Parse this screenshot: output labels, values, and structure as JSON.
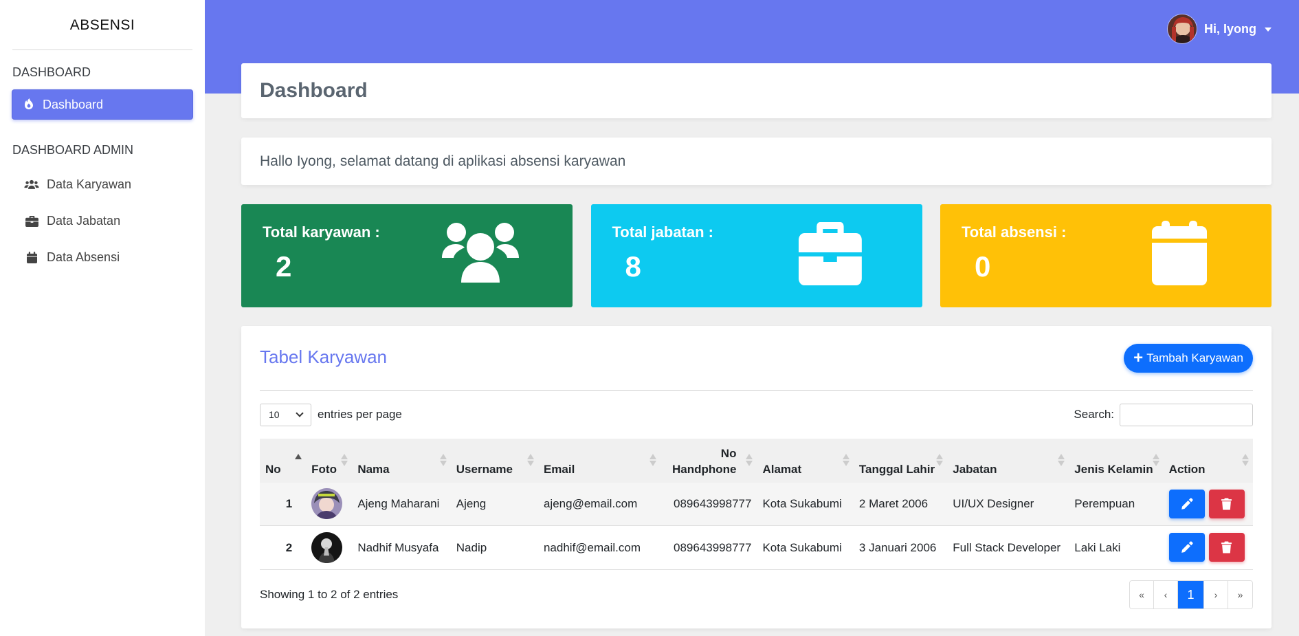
{
  "brand": "ABSENSI",
  "sidebar": {
    "section1": "DASHBOARD",
    "active_item": "Dashboard",
    "section2": "DASHBOARD ADMIN",
    "items": [
      {
        "label": "Data Karyawan",
        "icon": "users-icon"
      },
      {
        "label": "Data Jabatan",
        "icon": "briefcase-icon"
      },
      {
        "label": "Data Absensi",
        "icon": "calendar-icon"
      }
    ]
  },
  "topbar": {
    "greeting": "Hi, Iyong"
  },
  "page_title": "Dashboard",
  "welcome": "Hallo Iyong, selamat datang di aplikasi absensi karyawan",
  "stats": [
    {
      "label": "Total karyawan :",
      "value": "2",
      "color": "#198754",
      "icon": "users-icon"
    },
    {
      "label": "Total jabatan :",
      "value": "8",
      "color": "#0dcaf0",
      "icon": "briefcase-icon"
    },
    {
      "label": "Total absensi :",
      "value": "0",
      "color": "#ffc107",
      "icon": "calendar-icon"
    }
  ],
  "table": {
    "title": "Tabel Karyawan",
    "add_button": "Tambah Karyawan",
    "per_page_value": "10",
    "per_page_label": "entries per page",
    "search_label": "Search:",
    "headers": [
      "No",
      "Foto",
      "Nama",
      "Username",
      "Email",
      "No Handphone",
      "Alamat",
      "Tanggal Lahir",
      "Jabatan",
      "Jenis Kelamin",
      "Action"
    ],
    "rows": [
      {
        "no": "1",
        "nama": "Ajeng Maharani",
        "username": "Ajeng",
        "email": "ajeng@email.com",
        "hp": "089643998777",
        "alamat": "Kota Sukabumi",
        "tgl": "2 Maret 2006",
        "jabatan": "UI/UX Designer",
        "jk": "Perempuan"
      },
      {
        "no": "2",
        "nama": "Nadhif Musyafa",
        "username": "Nadip",
        "email": "nadhif@email.com",
        "hp": "089643998777",
        "alamat": "Kota Sukabumi",
        "tgl": "3 Januari 2006",
        "jabatan": "Full Stack Developer",
        "jk": "Laki Laki"
      }
    ],
    "info": "Showing 1 to 2 of 2 entries",
    "pager": [
      "«",
      "‹",
      "1",
      "›",
      "»"
    ]
  },
  "colors": {
    "accent": "#6777ef",
    "edit": "#0d6efd",
    "delete": "#dc3545"
  }
}
